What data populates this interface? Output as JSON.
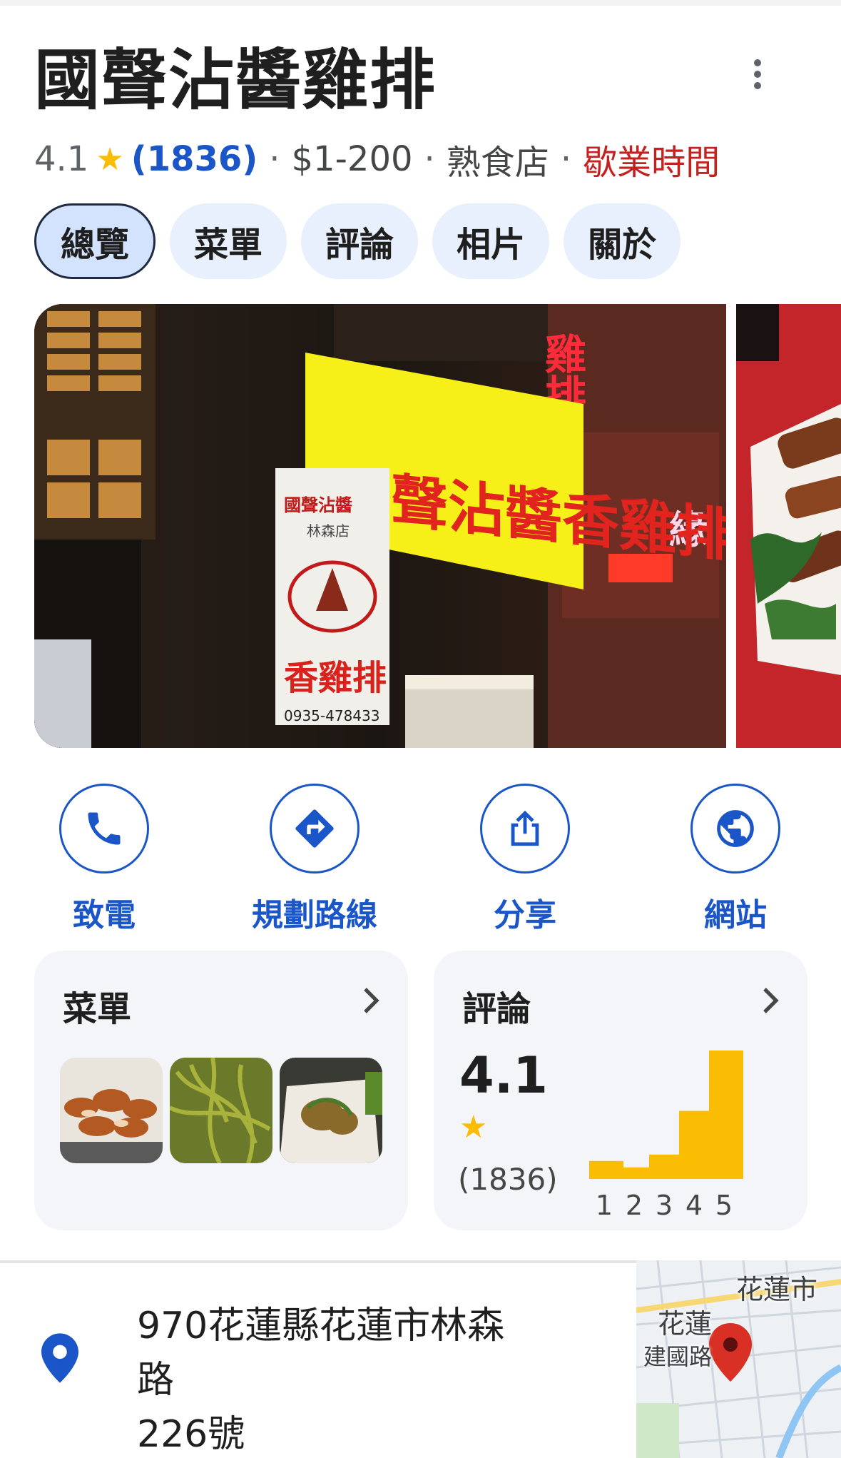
{
  "place": {
    "name": "國聲沾醬雞排",
    "rating": "4.1",
    "review_count": "(1836)",
    "price": "$1-200",
    "category": "熟食店",
    "hours_status": "歇業時間",
    "separator": "·"
  },
  "tabs": [
    {
      "label": "總覽",
      "active": true
    },
    {
      "label": "菜單",
      "active": false
    },
    {
      "label": "評論",
      "active": false
    },
    {
      "label": "相片",
      "active": false
    },
    {
      "label": "關於",
      "active": false
    }
  ],
  "photo": {
    "sign_main": "國聲沾醬香雞排",
    "sign_small_top": "國聲沾醬",
    "sign_small_branch": "林森店",
    "sign_small_bottom": "香雞排",
    "sign_small_phone": "0935-478433",
    "sign_red": "雞排"
  },
  "actions": [
    {
      "label": "致電",
      "icon": "phone-icon"
    },
    {
      "label": "規劃路線",
      "icon": "directions-icon"
    },
    {
      "label": "分享",
      "icon": "share-icon"
    },
    {
      "label": "網站",
      "icon": "globe-icon"
    }
  ],
  "menu_card": {
    "title": "菜單"
  },
  "reviews_card": {
    "title": "評論",
    "rating": "4.1",
    "count": "(1836)",
    "histogram": [
      {
        "star": "1",
        "share": 0.14
      },
      {
        "star": "2",
        "share": 0.09
      },
      {
        "star": "3",
        "share": 0.19
      },
      {
        "star": "4",
        "share": 0.53
      },
      {
        "star": "5",
        "share": 1.0
      }
    ]
  },
  "address": {
    "line1": "970花蓮縣花蓮市林森路",
    "line2": "226號"
  },
  "map": {
    "label_city": "花蓮市",
    "label_area": "花蓮",
    "label_road": "建國路"
  },
  "colors": {
    "accent_blue": "#1a56c8",
    "star_yellow": "#fbbc04",
    "closed_red": "#c5221f",
    "chip_bg": "#e8f0fe",
    "card_bg": "#f3f5f8",
    "pin_red": "#d93025"
  }
}
